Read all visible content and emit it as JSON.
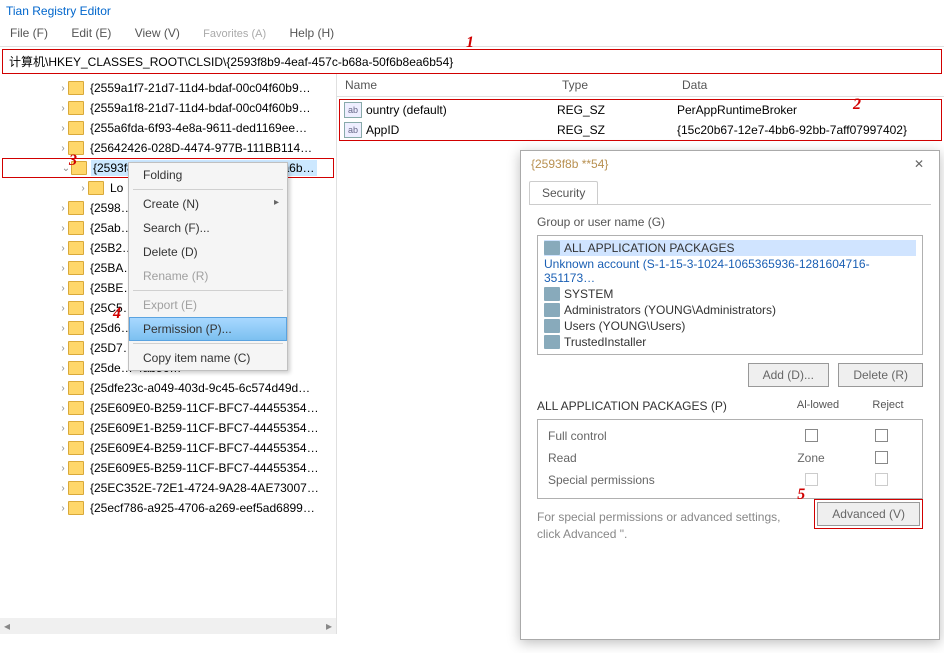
{
  "app_title": "Tian Registry Editor",
  "menu": {
    "file": "File (F)",
    "edit": "Edit (E)",
    "view": "View (V)",
    "fav": "Favorites (A)",
    "help": "Help (H)"
  },
  "path": "计算机\\HKEY_CLASSES_ROOT\\CLSID\\{2593f8b9-4eaf-457c-b68a-50f6b8ea6b54}",
  "ann": {
    "a1": "1",
    "a2": "2",
    "a3": "3",
    "a4": "4",
    "a5": "5"
  },
  "tree": [
    "{2559a1f7-21d7-11d4-bdaf-00c04f60b9…",
    "{2559a1f8-21d7-11d4-bdaf-00c04f60b9…",
    "{255a6fda-6f93-4e8a-9611-ded1169ee…",
    "{25642426-028D-4474-977B-111BB114…",
    "{2593f8b9-4eaf-457c-b68a-50f6b8ea6b…",
    "Lo",
    "{2598… 0D90…",
    "{25ab… 3546…",
    "{25B2… 8189…",
    "{25BA… 04F79…",
    "{25BE… 4FD8…",
    "{25C5… 4084B…",
    "{25d6… 343b3…",
    "{25D7… 93699…",
    "{25de… 4ab56…",
    "{25dfe23c-a049-403d-9c45-6c574d49d…",
    "{25E609E0-B259-11CF-BFC7-44455354…",
    "{25E609E1-B259-11CF-BFC7-44455354…",
    "{25E609E4-B259-11CF-BFC7-44455354…",
    "{25E609E5-B259-11CF-BFC7-44455354…",
    "{25EC352E-72E1-4724-9A28-4AE73007…",
    "{25ecf786-a925-4706-a269-eef5ad6899…"
  ],
  "ctx": {
    "folding": "Folding",
    "create": "Create (N)",
    "search": "Search (F)...",
    "delete": "Delete (D)",
    "rename": "Rename (R)",
    "export": "Export (E)",
    "permission": "Permission (P)...",
    "copy": "Copy item name (C)"
  },
  "cols": {
    "name": "Name",
    "type": "Type",
    "data": "Data"
  },
  "vals": [
    {
      "icon": "ab",
      "name": "ountry (default)",
      "type": "REG_SZ",
      "data": "PerAppRuntimeBroker"
    },
    {
      "icon": "ab",
      "name": "AppID",
      "type": "REG_SZ",
      "data": "{15c20b67-12e7-4bb6-92bb-7aff07997402}"
    }
  ],
  "dlg": {
    "title": "{2593f8b **54}",
    "tab": "Security",
    "group_label": "Group or user name (G)",
    "groups": [
      "ALL APPLICATION PACKAGES",
      "Unknown account (S-1-15-3-1024-1065365936-1281604716-351173…",
      "SYSTEM",
      "Administrators (YOUNG\\Administrators)",
      "Users (YOUNG\\Users)",
      "TrustedInstaller"
    ],
    "add": "Add (D)...",
    "delete": "Delete (R)",
    "perm_title": "ALL APPLICATION PACKAGES (P)",
    "allow": "Al-lowed",
    "deny": "Reject",
    "perms": [
      "Full control",
      "Read",
      "Special permissions"
    ],
    "zone": "Zone",
    "note": "For special permissions or advanced settings, click Advanced \".",
    "advanced": "Advanced (V)"
  }
}
